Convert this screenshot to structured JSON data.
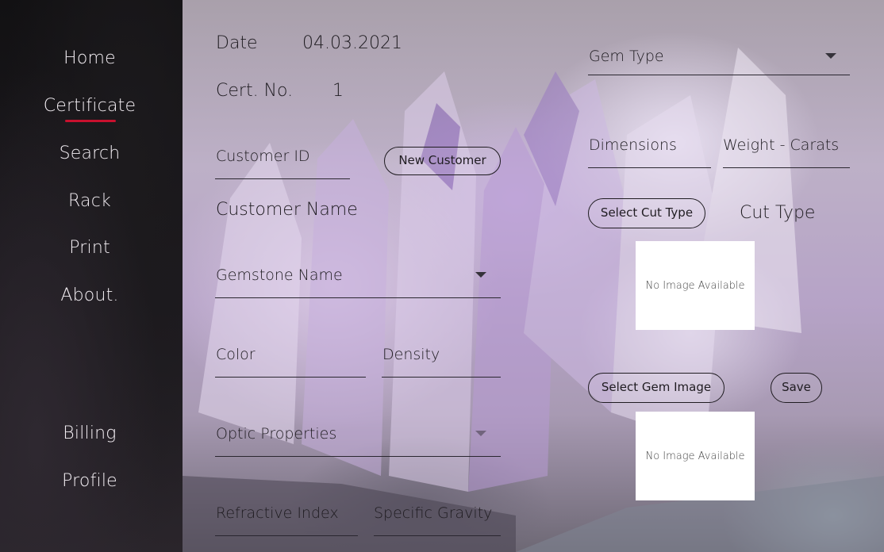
{
  "sidebar": {
    "items": [
      {
        "label": "Home"
      },
      {
        "label": "Certificate"
      },
      {
        "label": "Search"
      },
      {
        "label": "Rack"
      },
      {
        "label": "Print"
      },
      {
        "label": "About."
      },
      {
        "label": "Billing"
      },
      {
        "label": "Profile"
      }
    ],
    "active": "Certificate",
    "accent_color": "#c8102e"
  },
  "form": {
    "date_label": "Date",
    "date_value": "04.03.2021",
    "cert_label": "Cert. No.",
    "cert_value": "1",
    "customer_id_placeholder": "Customer ID",
    "new_customer_button": "New Customer",
    "customer_name": "Customer Name",
    "gemstone_name_placeholder": "Gemstone Name",
    "color_placeholder": "Color",
    "density_placeholder": "Density",
    "optic_properties_placeholder": "Optic Properties",
    "refractive_index_placeholder": "Refractive Index",
    "specific_gravity_placeholder": "Specific Gravity",
    "gem_type_placeholder": "Gem Type",
    "dimensions_placeholder": "Dimensions",
    "weight_placeholder": "Weight - Carats",
    "select_cut_type_button": "Select Cut Type",
    "cut_type_label": "Cut Type",
    "cut_image_text": "No Image Available",
    "select_gem_image_button": "Select Gem Image",
    "save_button": "Save",
    "gem_image_text": "No Image Available"
  }
}
